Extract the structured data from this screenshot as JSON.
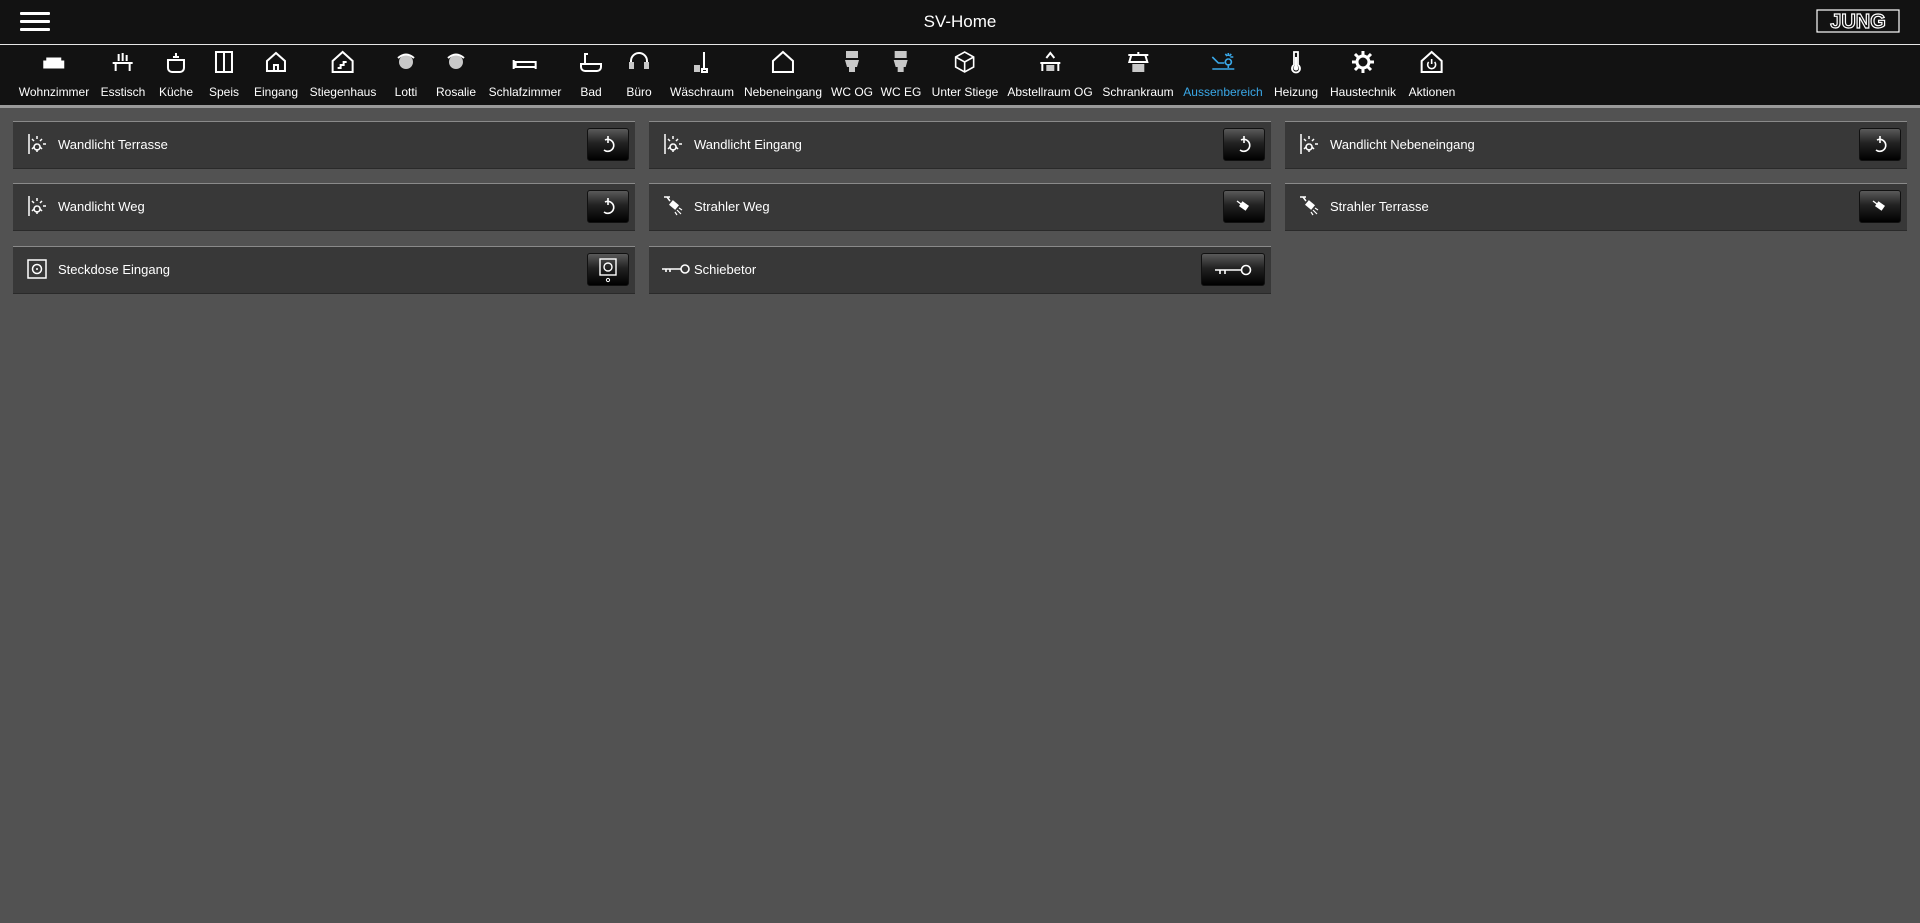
{
  "header": {
    "title": "SV-Home",
    "logo_text": "JUNG"
  },
  "rooms": [
    {
      "label": "Wohnzimmer",
      "icon": "sofa-icon"
    },
    {
      "label": "Esstisch",
      "icon": "dining-table-icon"
    },
    {
      "label": "Küche",
      "icon": "cooking-pot-icon"
    },
    {
      "label": "Speis",
      "icon": "pantry-door-icon"
    },
    {
      "label": "Eingang",
      "icon": "house-entrance-icon"
    },
    {
      "label": "Stiegenhaus",
      "icon": "house-stairs-icon"
    },
    {
      "label": "Lotti",
      "icon": "child-face-icon"
    },
    {
      "label": "Rosalie",
      "icon": "child-face-icon"
    },
    {
      "label": "Schlafzimmer",
      "icon": "bed-icon"
    },
    {
      "label": "Bad",
      "icon": "bathtub-icon"
    },
    {
      "label": "Büro",
      "icon": "headset-icon"
    },
    {
      "label": "Wäschraum",
      "icon": "vacuum-icon"
    },
    {
      "label": "Nebeneingang",
      "icon": "house-icon"
    },
    {
      "label": "WC OG",
      "icon": "toilet-icon"
    },
    {
      "label": "WC EG",
      "icon": "toilet-icon"
    },
    {
      "label": "Unter Stiege",
      "icon": "box-icon"
    },
    {
      "label": "Abstellraum OG",
      "icon": "storage-room-icon"
    },
    {
      "label": "Schrankraum",
      "icon": "wardrobe-icon"
    },
    {
      "label": "Aussenbereich",
      "icon": "outdoor-light-icon",
      "active": true
    },
    {
      "label": "Heizung",
      "icon": "thermometer-icon"
    },
    {
      "label": "Haustechnik",
      "icon": "gear-icon"
    },
    {
      "label": "Aktionen",
      "icon": "house-power-icon"
    }
  ],
  "tiles": [
    {
      "label": "Wandlicht Terrasse",
      "icon": "wall-light-icon",
      "button_icon": "power-icon"
    },
    {
      "label": "Wandlicht Eingang",
      "icon": "wall-light-icon",
      "button_icon": "power-icon"
    },
    {
      "label": "Wandlicht Nebeneingang",
      "icon": "wall-light-icon",
      "button_icon": "power-icon"
    },
    {
      "label": "Wandlicht Weg",
      "icon": "wall-light-icon",
      "button_icon": "power-icon"
    },
    {
      "label": "Strahler Weg",
      "icon": "spotlight-icon",
      "button_icon": "spotlight-icon"
    },
    {
      "label": "Strahler Terrasse",
      "icon": "spotlight-icon",
      "button_icon": "spotlight-icon"
    },
    {
      "label": "Steckdose Eingang",
      "icon": "socket-icon",
      "button_icon": "socket-icon"
    },
    {
      "label": "Schiebetor",
      "icon": "key-icon",
      "button_icon": "key-icon"
    }
  ],
  "colors": {
    "background": "#525252",
    "bar": "#121212",
    "tile": "#383838",
    "active": "#3aa8e8"
  }
}
